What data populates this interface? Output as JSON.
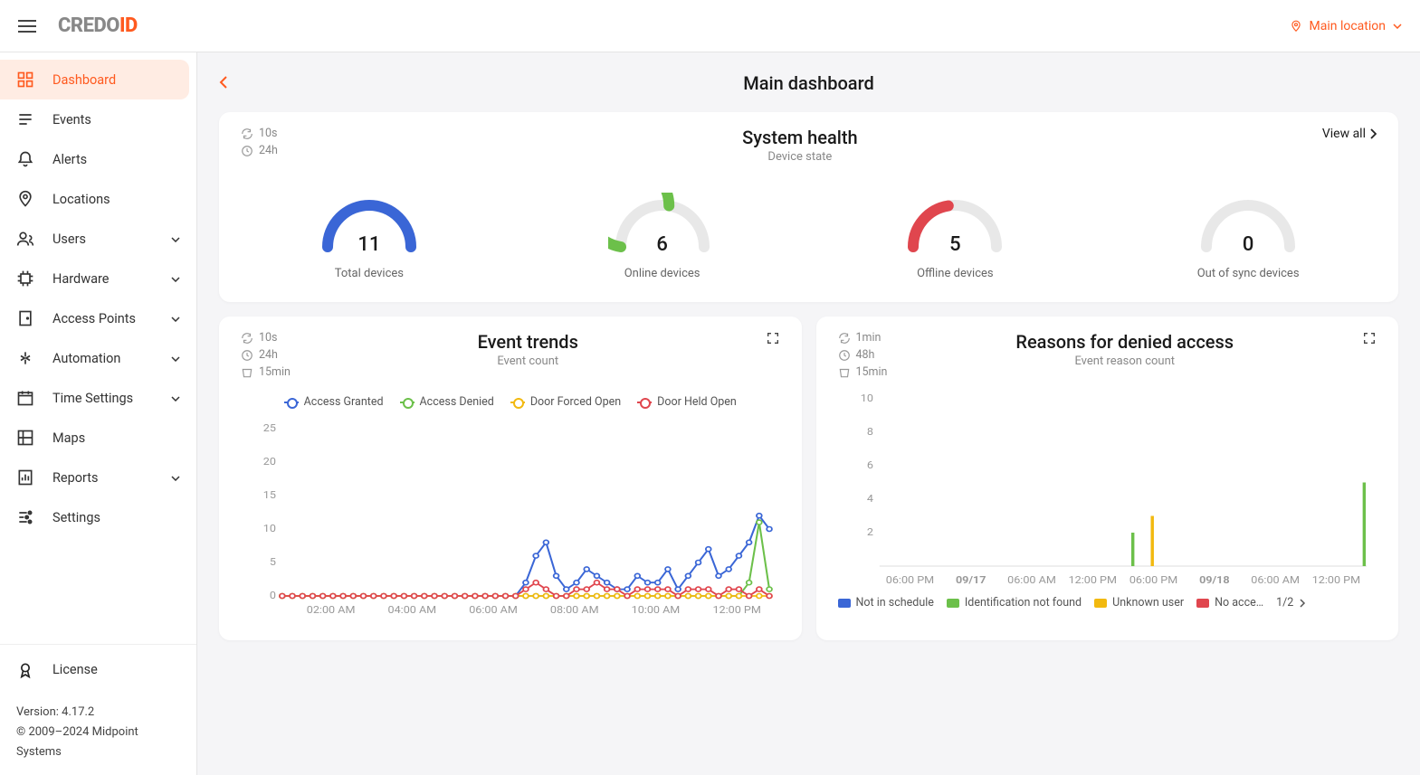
{
  "header": {
    "logo_part1": "CREDO",
    "logo_part2": "ID",
    "location": "Main location"
  },
  "sidebar": {
    "items": [
      {
        "label": "Dashboard",
        "icon": "dashboard-icon",
        "active": true
      },
      {
        "label": "Events",
        "icon": "events-icon"
      },
      {
        "label": "Alerts",
        "icon": "alerts-icon"
      },
      {
        "label": "Locations",
        "icon": "locations-icon"
      },
      {
        "label": "Users",
        "icon": "users-icon",
        "expand": true
      },
      {
        "label": "Hardware",
        "icon": "hardware-icon",
        "expand": true
      },
      {
        "label": "Access Points",
        "icon": "access-points-icon",
        "expand": true
      },
      {
        "label": "Automation",
        "icon": "automation-icon",
        "expand": true
      },
      {
        "label": "Time Settings",
        "icon": "time-settings-icon",
        "expand": true
      },
      {
        "label": "Maps",
        "icon": "maps-icon"
      },
      {
        "label": "Reports",
        "icon": "reports-icon",
        "expand": true
      },
      {
        "label": "Settings",
        "icon": "settings-icon"
      }
    ],
    "license_label": "License",
    "version_label": "Version:",
    "version": "4.17.2",
    "copyright": "© 2009–2024 Midpoint Systems"
  },
  "page": {
    "title": "Main dashboard"
  },
  "system_health": {
    "title": "System health",
    "subtitle": "Device state",
    "view_all": "View all",
    "refresh": "10s",
    "window": "24h",
    "gauges": [
      {
        "value": "11",
        "label": "Total devices",
        "color": "#3a66d6",
        "pct": 1.0
      },
      {
        "value": "6",
        "label": "Online devices",
        "color": "#6cc04a",
        "pct": 0.55
      },
      {
        "value": "5",
        "label": "Offline devices",
        "color": "#e0464e",
        "pct": 0.45
      },
      {
        "value": "0",
        "label": "Out of sync devices",
        "color": "#dcdcdc",
        "pct": 0.0
      }
    ]
  },
  "event_trends": {
    "title": "Event trends",
    "subtitle": "Event count",
    "refresh": "10s",
    "window": "24h",
    "bucket": "15min",
    "legend": [
      {
        "label": "Access Granted",
        "color": "#3a66d6"
      },
      {
        "label": "Access Denied",
        "color": "#6cc04a"
      },
      {
        "label": "Door Forced Open",
        "color": "#f2b90f"
      },
      {
        "label": "Door Held Open",
        "color": "#e0464e"
      }
    ]
  },
  "denied": {
    "title": "Reasons for denied access",
    "subtitle": "Event reason count",
    "refresh": "1min",
    "window": "48h",
    "bucket": "15min",
    "legend": [
      {
        "label": "Not in schedule",
        "color": "#3a66d6"
      },
      {
        "label": "Identification not found",
        "color": "#6cc04a"
      },
      {
        "label": "Unknown user",
        "color": "#f2b90f"
      },
      {
        "label": "No acce…",
        "color": "#e0464e"
      }
    ],
    "page": "1/2"
  },
  "chart_data": [
    {
      "type": "line",
      "title": "Event trends",
      "ylabel": "Event count",
      "ylim": [
        0,
        25
      ],
      "y_ticks": [
        0,
        5,
        10,
        15,
        20,
        25
      ],
      "x_ticks": [
        "02:00 AM",
        "04:00 AM",
        "06:00 AM",
        "08:00 AM",
        "10:00 AM",
        "12:00 PM"
      ],
      "x": [
        "01:00",
        "01:15",
        "01:30",
        "01:45",
        "02:00",
        "02:15",
        "02:30",
        "02:45",
        "03:00",
        "03:15",
        "03:30",
        "03:45",
        "04:00",
        "04:15",
        "04:30",
        "04:45",
        "05:00",
        "05:15",
        "05:30",
        "05:45",
        "06:00",
        "06:15",
        "06:30",
        "06:45",
        "07:00",
        "07:15",
        "07:30",
        "07:45",
        "08:00",
        "08:15",
        "08:30",
        "08:45",
        "09:00",
        "09:15",
        "09:30",
        "09:45",
        "10:00",
        "10:15",
        "10:30",
        "10:45",
        "11:00",
        "11:15",
        "11:30",
        "11:45",
        "12:00",
        "12:15",
        "12:30",
        "12:45",
        "13:00"
      ],
      "series": [
        {
          "name": "Access Granted",
          "color": "#3a66d6",
          "values": [
            0,
            0,
            0,
            0,
            0,
            0,
            0,
            0,
            0,
            0,
            0,
            0,
            0,
            0,
            0,
            0,
            0,
            0,
            0,
            0,
            0,
            0,
            0,
            0,
            2,
            6,
            8,
            3,
            1,
            2,
            4,
            3,
            2,
            1,
            1,
            3,
            2,
            2,
            4,
            1,
            3,
            5,
            7,
            3,
            4,
            6,
            8,
            12,
            10
          ]
        },
        {
          "name": "Access Denied",
          "color": "#6cc04a",
          "values": [
            0,
            0,
            0,
            0,
            0,
            0,
            0,
            0,
            0,
            0,
            0,
            0,
            0,
            0,
            0,
            0,
            0,
            0,
            0,
            0,
            0,
            0,
            0,
            0,
            0,
            0,
            0,
            0,
            0,
            0,
            0,
            0,
            0,
            0,
            0,
            0,
            0,
            0,
            0,
            0,
            0,
            0,
            0,
            0,
            0,
            0,
            2,
            11,
            1
          ]
        },
        {
          "name": "Door Forced Open",
          "color": "#f2b90f",
          "values": [
            0,
            0,
            0,
            0,
            0,
            0,
            0,
            0,
            0,
            0,
            0,
            0,
            0,
            0,
            0,
            0,
            0,
            0,
            0,
            0,
            0,
            0,
            0,
            0,
            0,
            0,
            0,
            0,
            0,
            0,
            0,
            0,
            0,
            0,
            0,
            0,
            0,
            0,
            0,
            0,
            0,
            0,
            0,
            0,
            0,
            0,
            0,
            0,
            0
          ]
        },
        {
          "name": "Door Held Open",
          "color": "#e0464e",
          "values": [
            0,
            0,
            0,
            0,
            0,
            0,
            0,
            0,
            0,
            0,
            0,
            0,
            0,
            0,
            0,
            0,
            0,
            0,
            0,
            0,
            0,
            0,
            0,
            0,
            1,
            2,
            1,
            0,
            0,
            1,
            1,
            2,
            1,
            1,
            0,
            1,
            1,
            1,
            1,
            0,
            1,
            1,
            1,
            0,
            1,
            1,
            0,
            1,
            0
          ]
        }
      ]
    },
    {
      "type": "bar",
      "title": "Reasons for denied access",
      "ylabel": "Event reason count",
      "ylim": [
        0,
        10
      ],
      "y_ticks": [
        2,
        4,
        6,
        8,
        10
      ],
      "x_ticks": [
        "06:00 PM",
        "09/17",
        "06:00 AM",
        "12:00 PM",
        "06:00 PM",
        "09/18",
        "06:00 AM",
        "12:00 PM"
      ],
      "series": [
        {
          "name": "Not in schedule",
          "color": "#3a66d6",
          "bars": []
        },
        {
          "name": "Identification not found",
          "color": "#6cc04a",
          "bars": [
            {
              "x": "09/17 14:00",
              "y": 2
            },
            {
              "x": "09/18 12:45",
              "y": 5
            }
          ]
        },
        {
          "name": "Unknown user",
          "color": "#f2b90f",
          "bars": [
            {
              "x": "09/17 15:00",
              "y": 3
            }
          ]
        },
        {
          "name": "No access",
          "color": "#e0464e",
          "bars": []
        }
      ]
    }
  ]
}
